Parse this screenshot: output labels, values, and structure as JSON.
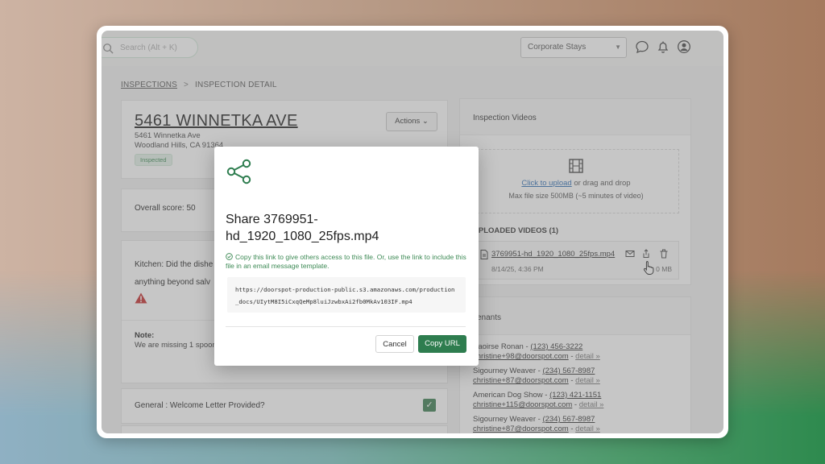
{
  "topbar": {
    "search_placeholder": "Search (Alt + K)",
    "company_select": "Corporate Stays"
  },
  "breadcrumb": {
    "parent": "INSPECTIONS",
    "separator": ">",
    "current": "INSPECTION DETAIL"
  },
  "property": {
    "title": "5461 WINNETKA AVE",
    "address_line1": "5461 Winnetka Ave",
    "address_line2": "Woodland Hills, CA 91364",
    "status": "Inspected",
    "actions_label": "Actions"
  },
  "score": {
    "label": "Overall score: 50"
  },
  "kitchen": {
    "question_part1": "Kitchen: Did the dishe",
    "question_part2": "anything beyond salv",
    "note_label": "Note:",
    "note_text": "We are missing 1 spoon"
  },
  "general": {
    "question": "General : Welcome Letter Provided?",
    "checked": true
  },
  "videos": {
    "heading": "Inspection Videos",
    "upload_link": "Click to upload",
    "upload_rest": " or drag and drop",
    "max_size": "Max file size 500MB (~5 minutes of video)",
    "uploaded_heading": "UPLOADED VIDEOS (1)",
    "item": {
      "name": "3769951-hd_1920_1080_25fps.mp4",
      "date": "8/14/25, 4:36 PM",
      "size": "0 MB"
    }
  },
  "tenants": {
    "heading": "Tenants",
    "list": [
      {
        "name": "Saoirse Ronan",
        "phone": "(123) 456-3222",
        "email": "christine+98@doorspot.com",
        "detail": "detail »"
      },
      {
        "name": "Sigourney Weaver",
        "phone": "(234) 567-8987",
        "email": "christine+87@doorspot.com",
        "detail": "detail »"
      },
      {
        "name": "American Dog Show",
        "phone": "(123) 421-1151",
        "email": "christine+115@doorspot.com",
        "detail": "detail »"
      },
      {
        "name": "Sigourney Weaver",
        "phone": "(234) 567-8987",
        "email": "christine+87@doorspot.com",
        "detail": "detail »"
      }
    ]
  },
  "modal": {
    "title": "Share 3769951-hd_1920_1080_25fps.mp4",
    "message": "Copy this link to give others access to this file. Or, use the link to include this file in an email message template.",
    "url": "https://doorspot-production-public.s3.amazonaws.com/production_docs/UIytM8I5iCxqQeMp8luiJzwbxAi2fb0MkAv103IF.mp4",
    "cancel_label": "Cancel",
    "copy_label": "Copy URL"
  },
  "colors": {
    "accent": "#2e7d4f",
    "link": "#2f6fb5"
  }
}
